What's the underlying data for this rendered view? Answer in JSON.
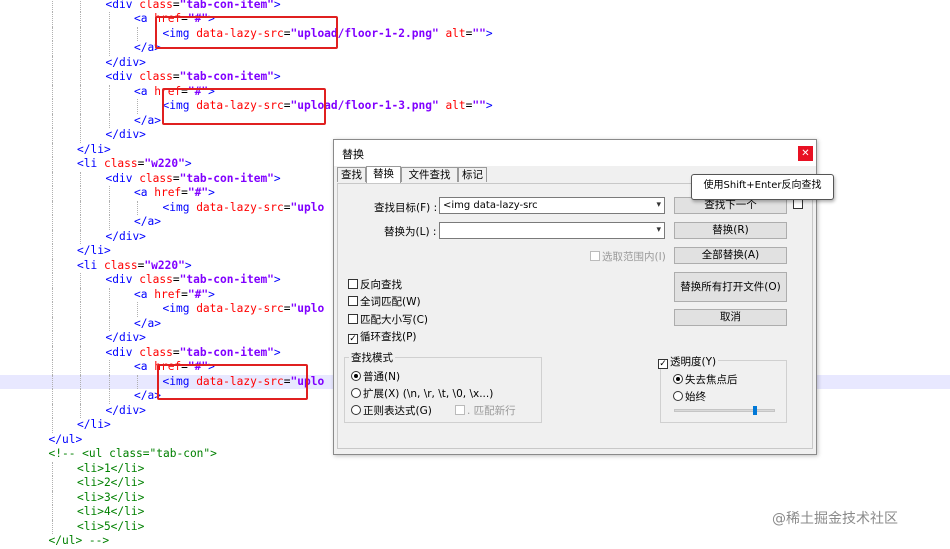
{
  "code_lines": [
    {
      "indent": 4,
      "tokens": [
        [
          "tk-tag",
          "<div "
        ],
        [
          "tk-attr",
          "class"
        ],
        [
          "tk-eq",
          "="
        ],
        [
          "tk-val",
          "\"tab-con-item\""
        ],
        [
          "tk-tag",
          ">"
        ]
      ]
    },
    {
      "indent": 5,
      "tokens": [
        [
          "tk-tag",
          "<a "
        ],
        [
          "tk-attr",
          "href"
        ],
        [
          "tk-eq",
          "="
        ],
        [
          "tk-val",
          "\"#\""
        ],
        [
          "tk-tag",
          ">"
        ]
      ]
    },
    {
      "indent": 6,
      "tokens": [
        [
          "tk-tag",
          "<img "
        ],
        [
          "tk-attr",
          "data-lazy-src"
        ],
        [
          "tk-eq",
          "="
        ],
        [
          "tk-val",
          "\"upload/floor-1-2.png\""
        ],
        [
          "tk-tag",
          " "
        ],
        [
          "tk-attr",
          "alt"
        ],
        [
          "tk-eq",
          "="
        ],
        [
          "tk-val",
          "\"\""
        ],
        [
          "tk-tag",
          ">"
        ]
      ]
    },
    {
      "indent": 5,
      "tokens": [
        [
          "tk-tag",
          "</a>"
        ]
      ]
    },
    {
      "indent": 4,
      "tokens": [
        [
          "tk-tag",
          "</div>"
        ]
      ]
    },
    {
      "indent": 4,
      "tokens": [
        [
          "tk-tag",
          "<div "
        ],
        [
          "tk-attr",
          "class"
        ],
        [
          "tk-eq",
          "="
        ],
        [
          "tk-val",
          "\"tab-con-item\""
        ],
        [
          "tk-tag",
          ">"
        ]
      ]
    },
    {
      "indent": 5,
      "tokens": [
        [
          "tk-tag",
          "<a "
        ],
        [
          "tk-attr",
          "href"
        ],
        [
          "tk-eq",
          "="
        ],
        [
          "tk-val",
          "\"#\""
        ],
        [
          "tk-tag",
          ">"
        ]
      ]
    },
    {
      "indent": 6,
      "tokens": [
        [
          "tk-tag",
          "<img "
        ],
        [
          "tk-attr",
          "data-lazy-src"
        ],
        [
          "tk-eq",
          "="
        ],
        [
          "tk-val",
          "\"upload/floor-1-3.png\""
        ],
        [
          "tk-tag",
          " "
        ],
        [
          "tk-attr",
          "alt"
        ],
        [
          "tk-eq",
          "="
        ],
        [
          "tk-val",
          "\"\""
        ],
        [
          "tk-tag",
          ">"
        ]
      ]
    },
    {
      "indent": 5,
      "tokens": [
        [
          "tk-tag",
          "</a>"
        ]
      ]
    },
    {
      "indent": 4,
      "tokens": [
        [
          "tk-tag",
          "</div>"
        ]
      ]
    },
    {
      "indent": 3,
      "tokens": [
        [
          "tk-tag",
          "</li>"
        ]
      ]
    },
    {
      "indent": 3,
      "tokens": [
        [
          "tk-tag",
          "<li "
        ],
        [
          "tk-attr",
          "class"
        ],
        [
          "tk-eq",
          "="
        ],
        [
          "tk-val",
          "\"w220\""
        ],
        [
          "tk-tag",
          ">"
        ]
      ]
    },
    {
      "indent": 4,
      "tokens": [
        [
          "tk-tag",
          "<div "
        ],
        [
          "tk-attr",
          "class"
        ],
        [
          "tk-eq",
          "="
        ],
        [
          "tk-val",
          "\"tab-con-item\""
        ],
        [
          "tk-tag",
          ">"
        ]
      ]
    },
    {
      "indent": 5,
      "tokens": [
        [
          "tk-tag",
          "<a "
        ],
        [
          "tk-attr",
          "href"
        ],
        [
          "tk-eq",
          "="
        ],
        [
          "tk-val",
          "\"#\""
        ],
        [
          "tk-tag",
          ">"
        ]
      ]
    },
    {
      "indent": 6,
      "tokens": [
        [
          "tk-tag",
          "<img "
        ],
        [
          "tk-attr",
          "data-lazy-src"
        ],
        [
          "tk-eq",
          "="
        ],
        [
          "tk-val",
          "\"uplo"
        ]
      ]
    },
    {
      "indent": 5,
      "tokens": [
        [
          "tk-tag",
          "</a>"
        ]
      ]
    },
    {
      "indent": 4,
      "tokens": [
        [
          "tk-tag",
          "</div>"
        ]
      ]
    },
    {
      "indent": 3,
      "tokens": [
        [
          "tk-tag",
          "</li>"
        ]
      ]
    },
    {
      "indent": 3,
      "tokens": [
        [
          "tk-tag",
          "<li "
        ],
        [
          "tk-attr",
          "class"
        ],
        [
          "tk-eq",
          "="
        ],
        [
          "tk-val",
          "\"w220\""
        ],
        [
          "tk-tag",
          ">"
        ]
      ]
    },
    {
      "indent": 4,
      "tokens": [
        [
          "tk-tag",
          "<div "
        ],
        [
          "tk-attr",
          "class"
        ],
        [
          "tk-eq",
          "="
        ],
        [
          "tk-val",
          "\"tab-con-item\""
        ],
        [
          "tk-tag",
          ">"
        ]
      ]
    },
    {
      "indent": 5,
      "tokens": [
        [
          "tk-tag",
          "<a "
        ],
        [
          "tk-attr",
          "href"
        ],
        [
          "tk-eq",
          "="
        ],
        [
          "tk-val",
          "\"#\""
        ],
        [
          "tk-tag",
          ">"
        ]
      ]
    },
    {
      "indent": 6,
      "tokens": [
        [
          "tk-tag",
          "<img "
        ],
        [
          "tk-attr",
          "data-lazy-src"
        ],
        [
          "tk-eq",
          "="
        ],
        [
          "tk-val",
          "\"uplo"
        ]
      ]
    },
    {
      "indent": 5,
      "tokens": [
        [
          "tk-tag",
          "</a>"
        ]
      ]
    },
    {
      "indent": 4,
      "tokens": [
        [
          "tk-tag",
          "</div>"
        ]
      ]
    },
    {
      "indent": 4,
      "tokens": [
        [
          "tk-tag",
          "<div "
        ],
        [
          "tk-attr",
          "class"
        ],
        [
          "tk-eq",
          "="
        ],
        [
          "tk-val",
          "\"tab-con-item\""
        ],
        [
          "tk-tag",
          ">"
        ]
      ]
    },
    {
      "indent": 5,
      "tokens": [
        [
          "tk-tag",
          "<a "
        ],
        [
          "tk-attr",
          "href"
        ],
        [
          "tk-eq",
          "="
        ],
        [
          "tk-val",
          "\"#\""
        ],
        [
          "tk-tag",
          ">"
        ]
      ]
    },
    {
      "indent": 6,
      "hl": true,
      "tokens": [
        [
          "tk-tag",
          "<img "
        ],
        [
          "tk-attr",
          "data-lazy-src"
        ],
        [
          "tk-eq",
          "="
        ],
        [
          "tk-val",
          "\"uplo"
        ]
      ]
    },
    {
      "indent": 5,
      "tokens": [
        [
          "tk-tag",
          "</a>"
        ]
      ]
    },
    {
      "indent": 4,
      "tokens": [
        [
          "tk-tag",
          "</div>"
        ]
      ]
    },
    {
      "indent": 3,
      "tokens": [
        [
          "tk-tag",
          "</li>"
        ]
      ]
    },
    {
      "indent": 2,
      "tokens": [
        [
          "tk-tag",
          "</ul>"
        ]
      ]
    },
    {
      "indent": 2,
      "tokens": [
        [
          "tk-cmt",
          "<!-- <ul class=\"tab-con\">"
        ]
      ]
    },
    {
      "indent": 3,
      "tokens": [
        [
          "tk-cmt",
          "<li>1</li>"
        ]
      ]
    },
    {
      "indent": 3,
      "tokens": [
        [
          "tk-cmt",
          "<li>2</li>"
        ]
      ]
    },
    {
      "indent": 3,
      "tokens": [
        [
          "tk-cmt",
          "<li>3</li>"
        ]
      ]
    },
    {
      "indent": 3,
      "tokens": [
        [
          "tk-cmt",
          "<li>4</li>"
        ]
      ]
    },
    {
      "indent": 3,
      "tokens": [
        [
          "tk-cmt",
          "<li>5</li>"
        ]
      ]
    },
    {
      "indent": 2,
      "tokens": [
        [
          "tk-cmt",
          "</ul> -->"
        ]
      ]
    }
  ],
  "dialog": {
    "title": "替换",
    "close": "✕",
    "tabs": [
      "查找",
      "替换",
      "文件查找",
      "标记"
    ],
    "find_label": "查找目标(F) :",
    "find_value": "<img data-lazy-src",
    "replace_label": "替换为(L) :",
    "replace_value": "",
    "in_selection": "选取范围内(I)",
    "options": {
      "reverse": "反向查找",
      "whole_word": "全词匹配(W)",
      "match_case": "匹配大小写(C)",
      "wrap": "循环查找(P)"
    },
    "search_mode": {
      "title": "查找模式",
      "normal": "普通(N)",
      "extended": "扩展(X) (\\n, \\r, \\t, \\0, \\x...)",
      "regex": "正则表达式(G)",
      "dot_newline": ". 匹配新行"
    },
    "buttons": {
      "find_next": "查找下一个",
      "replace": "替换(R)",
      "replace_all": "全部替换(A)",
      "replace_all_open": "替换所有打开文件(O)",
      "cancel": "取消"
    },
    "transparency": {
      "label": "透明度(Y)",
      "on_lose_focus": "失去焦点后",
      "always": "始终",
      "level": 0.8
    },
    "tooltip": "使用Shift+Enter反向查找"
  },
  "watermark": "@稀土掘金技术社区"
}
